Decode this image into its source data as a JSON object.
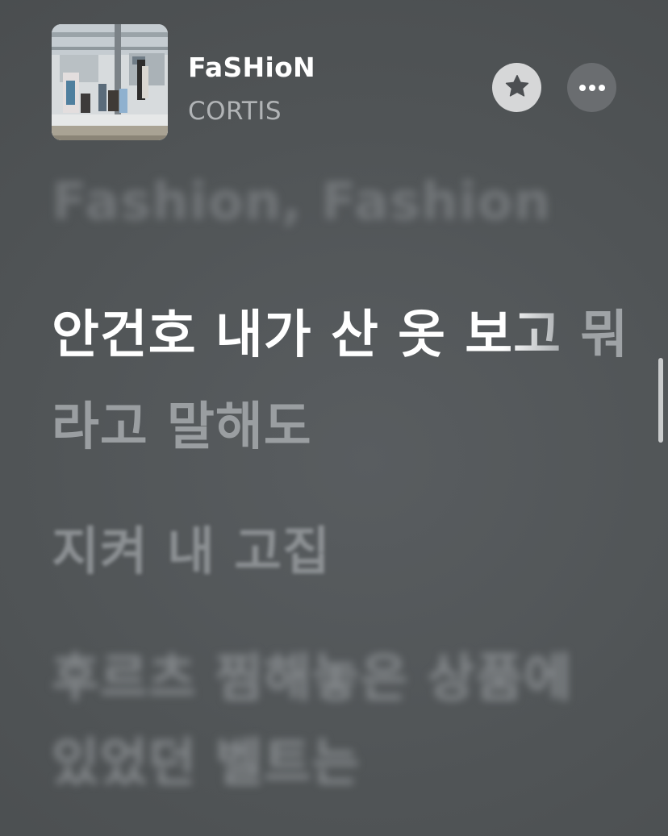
{
  "track": {
    "title": "FaSHioN",
    "artist": "CORTIS"
  },
  "icons": {
    "artwork": "album-artwork",
    "favorite": "star-icon",
    "more": "ellipsis-icon"
  },
  "lyrics": {
    "previous": "Fashion, Fashion",
    "current_line_1": "안건호 내가 산 옷 보고 뭐",
    "current_line_2": "라고 말해도",
    "next_1": "지켜 내 고집",
    "next_2": "후르츠 찜해놓은 상품에",
    "next_3": "있었던 벨트는"
  },
  "colors": {
    "background": "#505456",
    "active_lyric": "#ffffff",
    "inactive_lyric": "#9a9ea1",
    "artist": "#b1b4b6"
  }
}
